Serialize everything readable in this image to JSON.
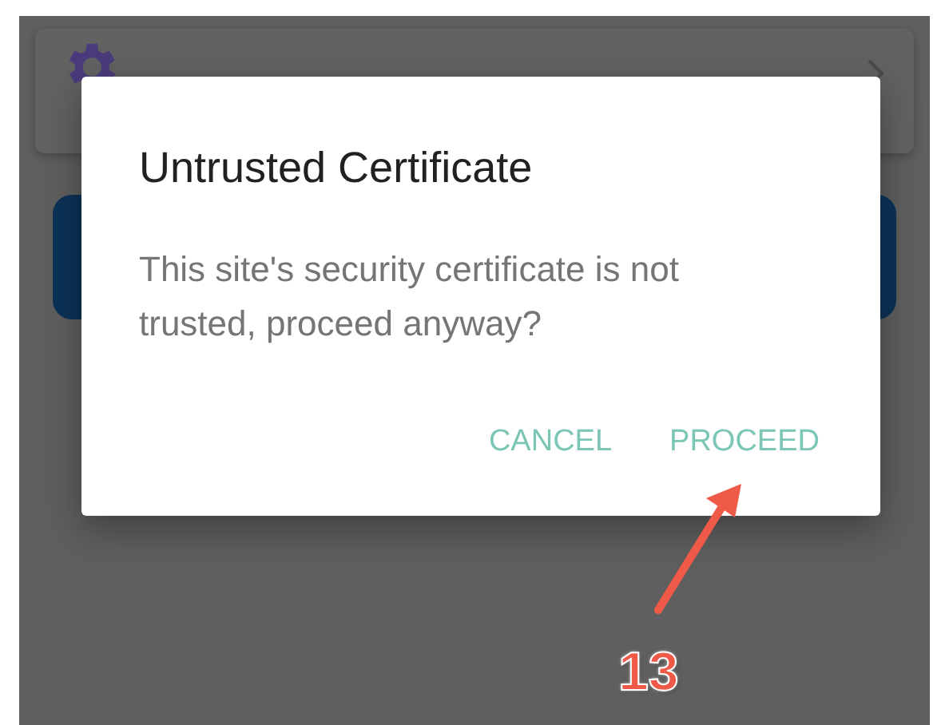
{
  "dialog": {
    "title": "Untrusted Certificate",
    "message": "This site's security certificate is not trusted, proceed anyway?",
    "buttons": [
      {
        "label": "CANCEL"
      },
      {
        "label": "PROCEED"
      }
    ]
  },
  "annotation": {
    "label": "13"
  }
}
